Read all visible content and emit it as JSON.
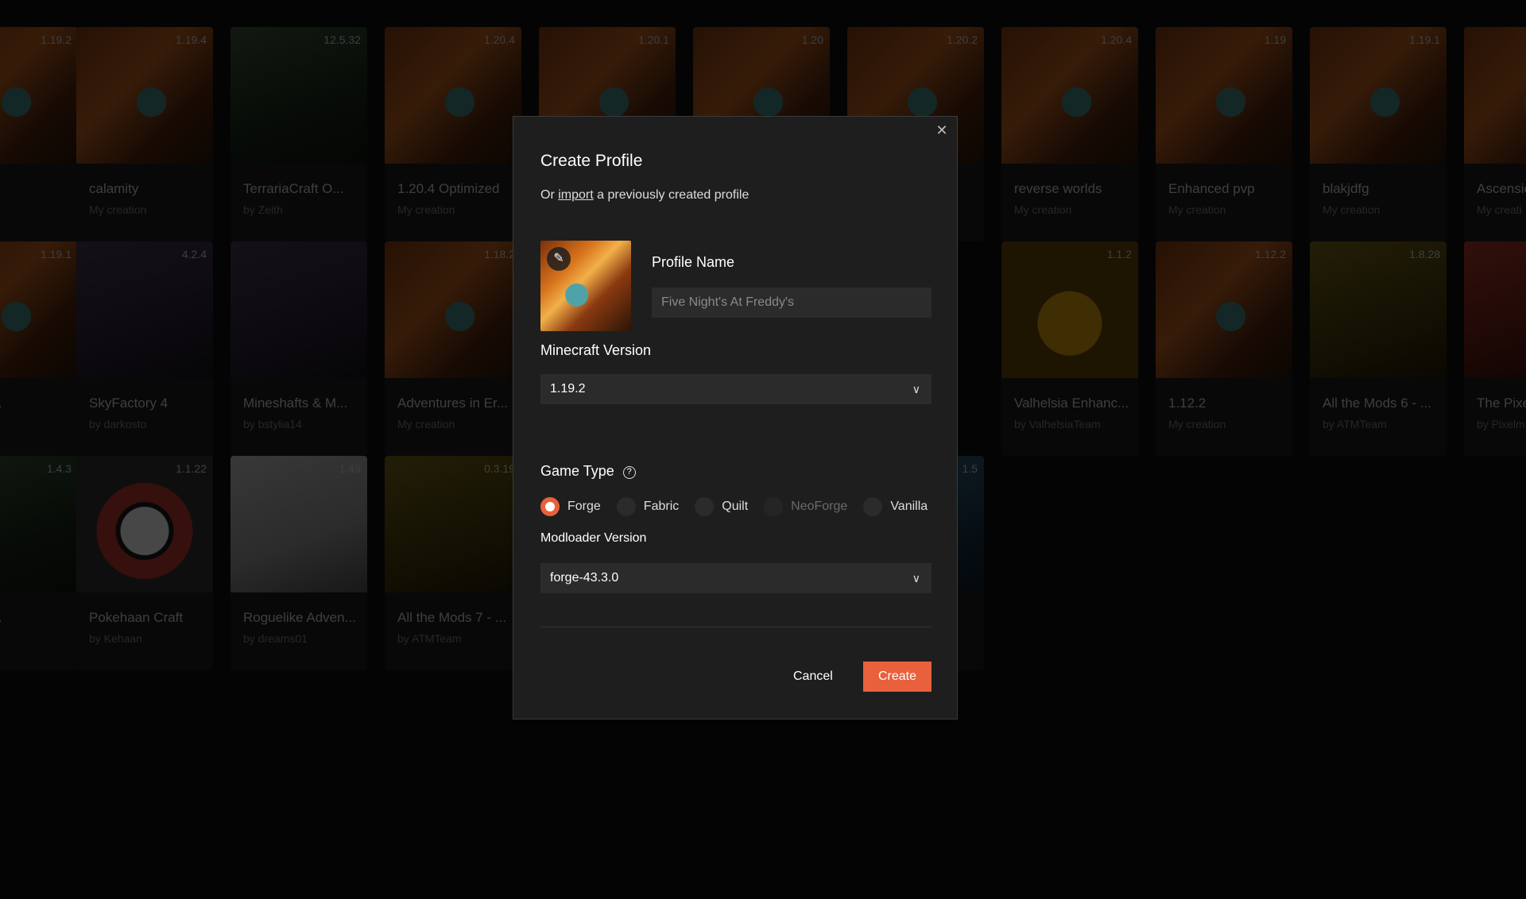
{
  "background_cards": [
    {
      "version": "1.19.2",
      "title": "",
      "subtitle": "",
      "theme": "orange"
    },
    {
      "version": "1.19.4",
      "title": "calamity",
      "subtitle": "My creation",
      "theme": "orange"
    },
    {
      "version": "12.5.32",
      "title": "TerrariaCraft O...",
      "subtitle": "by Zeith",
      "theme": "green"
    },
    {
      "version": "1.20.4",
      "title": "1.20.4 Optimized",
      "subtitle": "My creation",
      "theme": "orange"
    },
    {
      "version": "1.20.1",
      "title": "",
      "subtitle": "",
      "theme": "orange"
    },
    {
      "version": "1.20",
      "title": "",
      "subtitle": "",
      "theme": "orange"
    },
    {
      "version": "1.20.2",
      "title": "",
      "subtitle": "",
      "theme": "orange"
    },
    {
      "version": "1.20.4",
      "title": "reverse worlds",
      "subtitle": "My creation",
      "theme": "orange"
    },
    {
      "version": "1.19",
      "title": "Enhanced pvp",
      "subtitle": "My creation",
      "theme": "orange"
    },
    {
      "version": "1.19.1",
      "title": "blakjdfg",
      "subtitle": "My creation",
      "theme": "orange"
    },
    {
      "version": "",
      "title": "Ascensio",
      "subtitle": "My creati",
      "theme": "orange"
    },
    {
      "version": "1.19.1",
      "title": "re Pro...",
      "subtitle": "",
      "theme": "orange"
    },
    {
      "version": "4.2.4",
      "title": "SkyFactory 4",
      "subtitle": "by darkosto",
      "theme": "purple"
    },
    {
      "version": "",
      "title": "Mineshafts & M...",
      "subtitle": "by bstylia14",
      "theme": "purple"
    },
    {
      "version": "1.18.2",
      "title": "Adventures in Er...",
      "subtitle": "My creation",
      "theme": "orange"
    },
    {
      "version": "1.1.2",
      "title": "Valhelsia Enhanc...",
      "subtitle": "by ValhelsiaTeam",
      "theme": "amber"
    },
    {
      "version": "1.12.2",
      "title": "1.12.2",
      "subtitle": "My creation",
      "theme": "orange"
    },
    {
      "version": "1.8.28",
      "title": "All the Mods 6 - ...",
      "subtitle": "by ATMTeam",
      "theme": "yellow"
    },
    {
      "version": "",
      "title": "The Pixe",
      "subtitle": "by Pixelm",
      "theme": "red"
    },
    {
      "version": "1.4.3",
      "title": "The R...",
      "subtitle": "",
      "theme": "green"
    },
    {
      "version": "1.1.22",
      "title": "Pokehaan Craft",
      "subtitle": "by Kehaan",
      "theme": "pokeball"
    },
    {
      "version": "1.49",
      "title": "Roguelike Adven...",
      "subtitle": "by dreams01",
      "theme": "white"
    },
    {
      "version": "0.3.19",
      "title": "All the Mods 7 - ...",
      "subtitle": "by ATMTeam",
      "theme": "yellow"
    },
    {
      "version": "1.5",
      "title": "",
      "subtitle": "",
      "theme": "blue"
    }
  ],
  "modal": {
    "title": "Create Profile",
    "import_prefix": "Or",
    "import_link": "import",
    "import_suffix": "a previously created profile",
    "profile_name_label": "Profile Name",
    "profile_name_placeholder": "Five Night's At Freddy's",
    "minecraft_version_label": "Minecraft Version",
    "minecraft_version_value": "1.19.2",
    "game_type_label": "Game Type",
    "game_types": [
      {
        "label": "Forge",
        "selected": true,
        "disabled": false
      },
      {
        "label": "Fabric",
        "selected": false,
        "disabled": false
      },
      {
        "label": "Quilt",
        "selected": false,
        "disabled": false
      },
      {
        "label": "NeoForge",
        "selected": false,
        "disabled": true
      },
      {
        "label": "Vanilla",
        "selected": false,
        "disabled": false
      }
    ],
    "modloader_version_label": "Modloader Version",
    "modloader_version_value": "forge-43.3.0",
    "cancel_label": "Cancel",
    "create_label": "Create"
  },
  "colors": {
    "accent": "#e8603c",
    "modal_bg": "#1e1e1e",
    "input_bg": "#2b2b2b"
  }
}
